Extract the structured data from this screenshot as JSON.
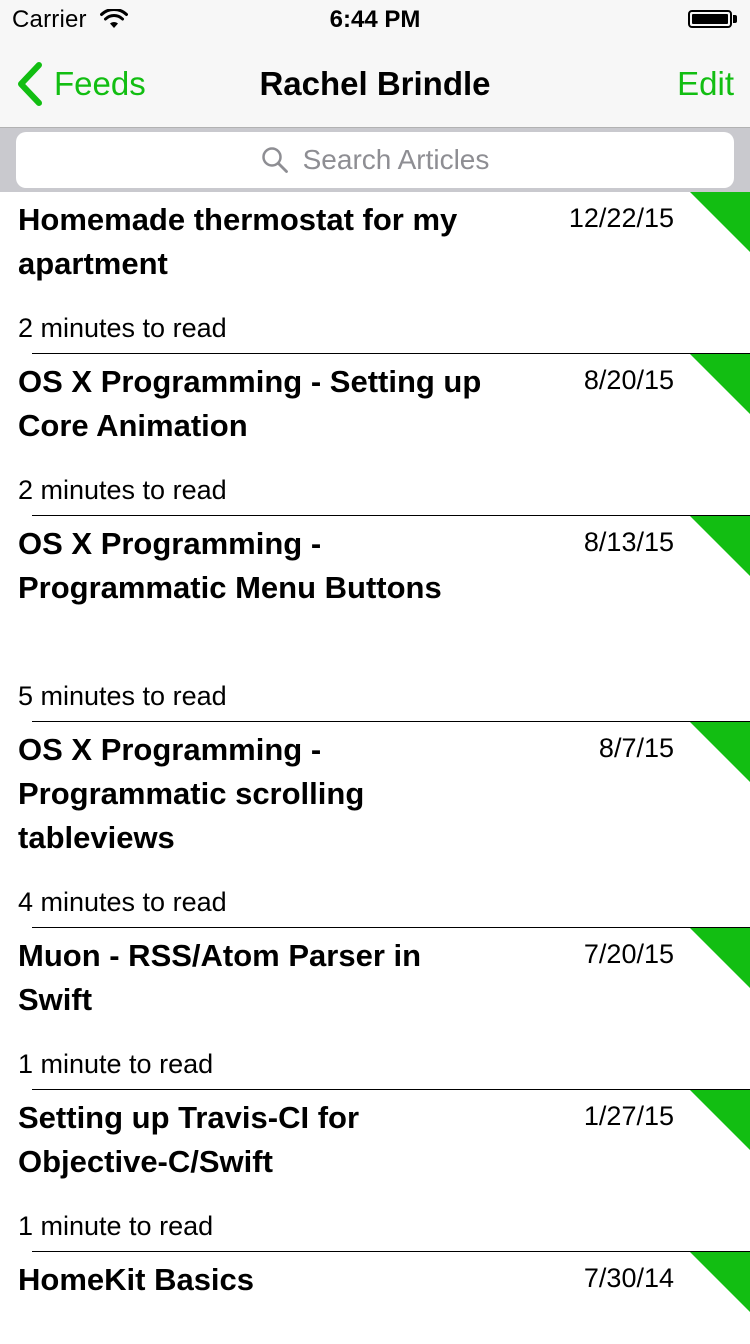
{
  "status_bar": {
    "carrier": "Carrier",
    "time": "6:44 PM"
  },
  "nav": {
    "back_label": "Feeds",
    "title": "Rachel Brindle",
    "edit_label": "Edit"
  },
  "search": {
    "placeholder": "Search Articles"
  },
  "colors": {
    "accent": "#12be12",
    "unread_marker": "#12be12"
  },
  "articles": [
    {
      "title": "Homemade thermostat for my apartment",
      "date": "12/22/15",
      "read_time": "2 minutes to read",
      "unread": true
    },
    {
      "title": "OS X Programming - Setting up Core Animation",
      "date": "8/20/15",
      "read_time": "2 minutes to read",
      "unread": true
    },
    {
      "title": "OS X Programming - Programmatic Menu Buttons",
      "date": "8/13/15",
      "read_time": "5 minutes to read",
      "unread": true
    },
    {
      "title": "OS X Programming - Programmatic scrolling tableviews",
      "date": "8/7/15",
      "read_time": "4 minutes to read",
      "unread": true
    },
    {
      "title": "Muon - RSS/Atom Parser in Swift",
      "date": "7/20/15",
      "read_time": "1 minute to read",
      "unread": true
    },
    {
      "title": "Setting up Travis-CI for Objective-C/Swift",
      "date": "1/27/15",
      "read_time": "1 minute to read",
      "unread": true
    },
    {
      "title": "HomeKit Basics",
      "date": "7/30/14",
      "read_time": "",
      "unread": true
    }
  ]
}
